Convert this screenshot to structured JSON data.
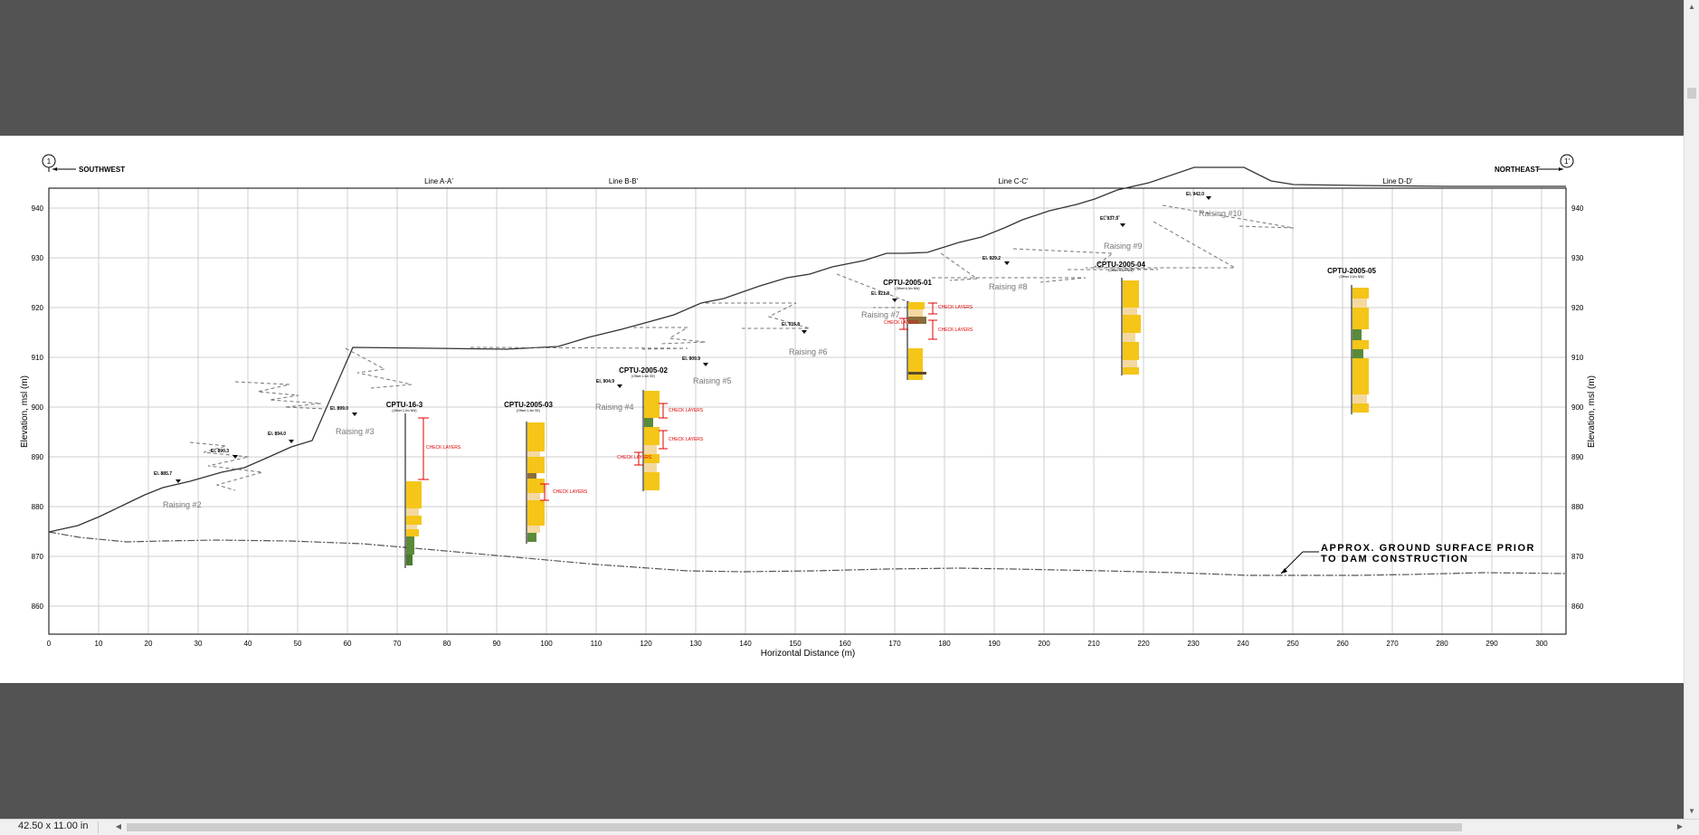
{
  "statusbar": {
    "page_size": "42.50 x 11.00 in"
  },
  "drawing": {
    "section_start_marker": "1",
    "section_end_marker": "1'",
    "direction_left": "SOUTHWEST",
    "direction_right": "NORTHEAST",
    "cross_section_lines": [
      "Line A-A'",
      "Line B-B'",
      "Line C-C'",
      "Line D-D'"
    ],
    "y_axis_label": "Elevation, msl (m)",
    "x_axis_label": "Horizontal Distance (m)",
    "x_ticks": [
      "0",
      "10",
      "20",
      "30",
      "40",
      "50",
      "60",
      "70",
      "80",
      "90",
      "100",
      "110",
      "120",
      "130",
      "140",
      "150",
      "160",
      "170",
      "180",
      "190",
      "200",
      "210",
      "220",
      "230",
      "240",
      "250",
      "260",
      "270",
      "280",
      "290",
      "300"
    ],
    "y_ticks": [
      "940",
      "930",
      "920",
      "910",
      "900",
      "890",
      "880",
      "870",
      "860"
    ],
    "raisings": [
      "Raising #2",
      "Raising #3",
      "Raising #4",
      "Raising #5",
      "Raising #6",
      "Raising #7",
      "Raising #8",
      "Raising #9",
      "Raising #10"
    ],
    "crest_elevations": [
      "El. 885.7",
      "El. 890.3",
      "El. 894.0",
      "El. 899.0",
      "El. 904.9",
      "El. 909.9",
      "El. 915.8",
      "El. 921.8",
      "El. 929.2",
      "El. 937.9",
      "El. 942.0"
    ],
    "cptu_soundings": [
      {
        "name": "CPTU-16-3",
        "sub": "(Offset 2.2m NW)"
      },
      {
        "name": "CPTU-2005-03",
        "sub": "(Offset 1.4m SE)"
      },
      {
        "name": "CPTU-2005-02",
        "sub": "(Offset 1.4m SE)"
      },
      {
        "name": "CPTU-2005-01",
        "sub": "(Offset 6.3m NW)"
      },
      {
        "name": "CPTU-2005-04",
        "sub": "(Offset 3.5m NW)"
      },
      {
        "name": "CPTU-2005-05",
        "sub": "(Offset 3.2m NW)"
      }
    ],
    "annotation_label": "CHECK LAYERS",
    "ground_note_line1": "APPROX. GROUND SURFACE PRIOR",
    "ground_note_line2": "TO DAM CONSTRUCTION",
    "colors": {
      "sand": "#f5c518",
      "silt_light": "#f3d9a0",
      "clay_green": "#5a8a3a",
      "organic_brown": "#8a6d3b",
      "annotation_red": "#e00000"
    }
  }
}
